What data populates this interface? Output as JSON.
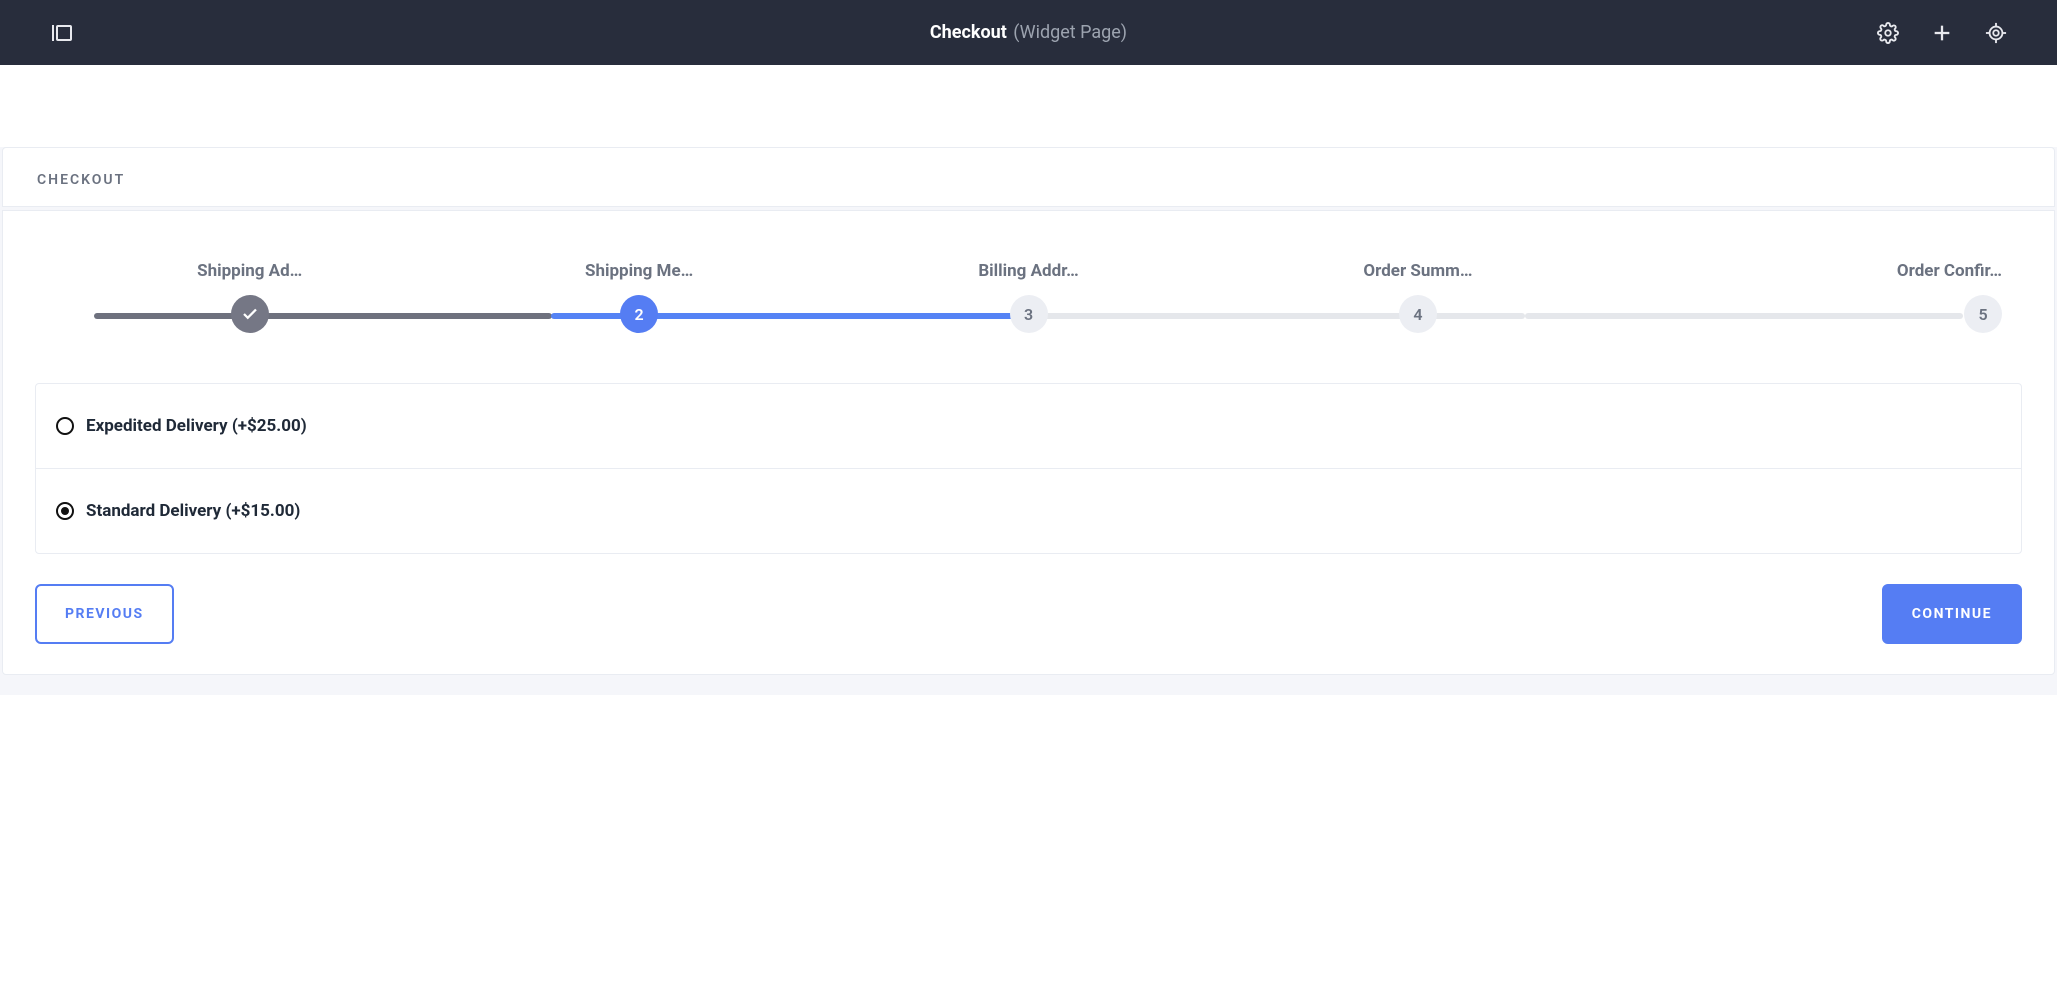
{
  "header": {
    "title": "Checkout",
    "subtitle": "(Widget Page)"
  },
  "card": {
    "title": "CHECKOUT"
  },
  "steps": [
    {
      "label": "Shipping Ad…",
      "indicator": "✓",
      "state": "done"
    },
    {
      "label": "Shipping Me…",
      "indicator": "2",
      "state": "active"
    },
    {
      "label": "Billing Addr…",
      "indicator": "3",
      "state": "idle"
    },
    {
      "label": "Order Summ…",
      "indicator": "4",
      "state": "idle"
    },
    {
      "label": "Order Confir…",
      "indicator": "5",
      "state": "idle"
    }
  ],
  "options": [
    {
      "label": "Expedited Delivery (+$25.00)",
      "selected": false
    },
    {
      "label": "Standard Delivery (+$15.00)",
      "selected": true
    }
  ],
  "buttons": {
    "previous": "Previous",
    "continue": "Continue"
  }
}
